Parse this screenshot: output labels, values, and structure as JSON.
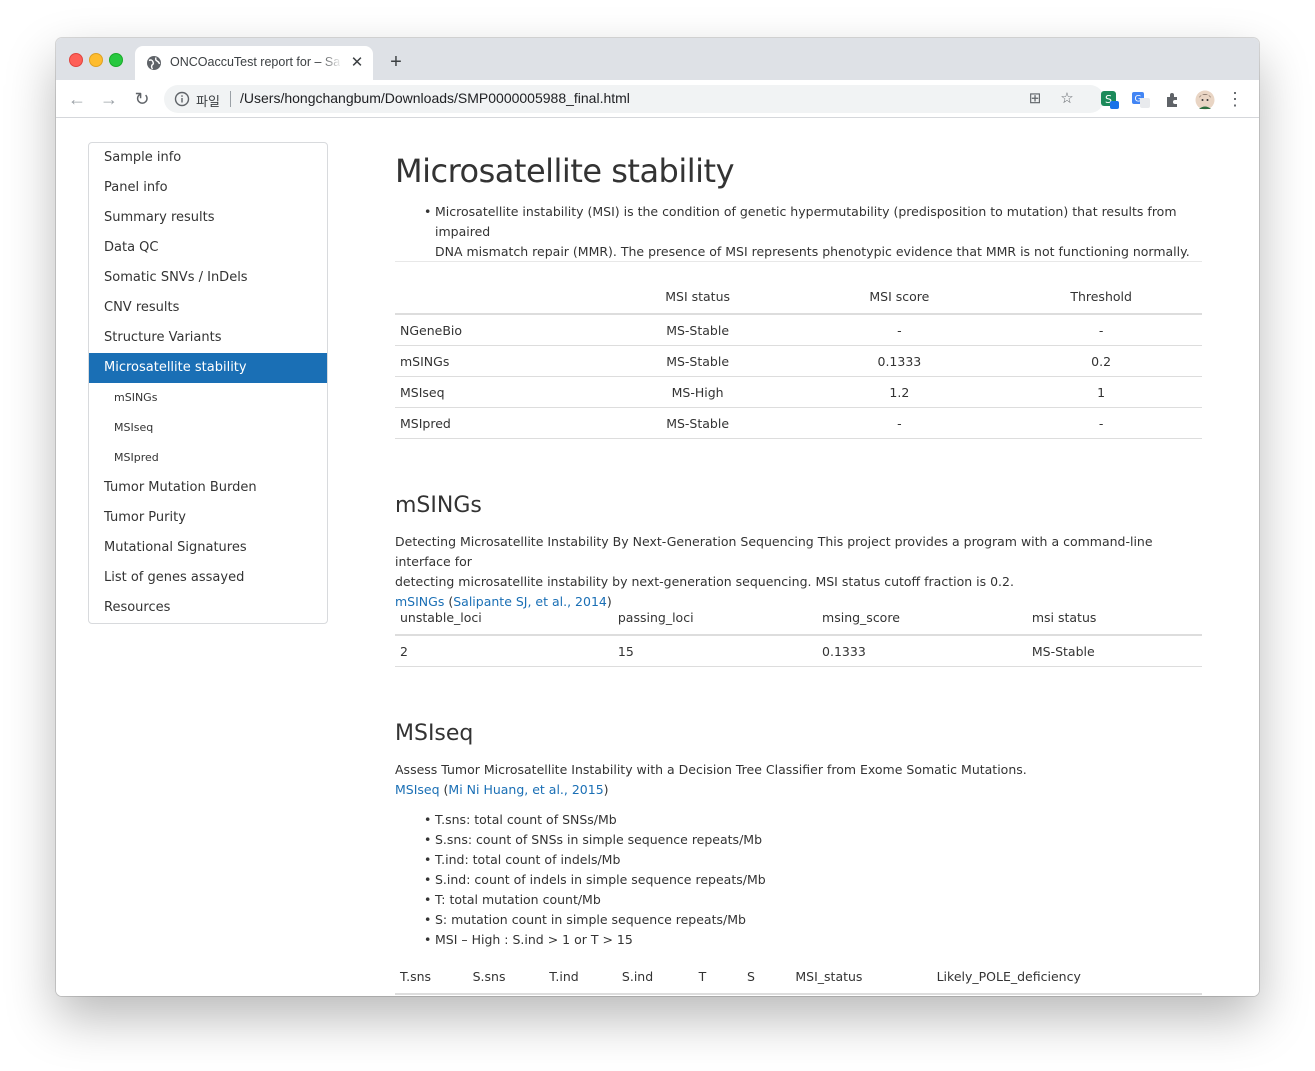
{
  "browser": {
    "tab_title": "ONCOaccuTest report for – Sample",
    "tab_close": "✕",
    "new_tab": "+",
    "nav_back": "←",
    "nav_forward": "→",
    "nav_reload": "↻",
    "scheme_label": "파일",
    "url": "/Users/hongchangbum/Downloads/SMP0000005988_final.html",
    "translate_icon": "⊞",
    "star_icon": "☆",
    "menu_icon": "⋮"
  },
  "sidebar": {
    "items": [
      {
        "label": "Sample info",
        "level": 1,
        "active": false
      },
      {
        "label": "Panel info",
        "level": 1,
        "active": false
      },
      {
        "label": "Summary results",
        "level": 1,
        "active": false
      },
      {
        "label": "Data QC",
        "level": 1,
        "active": false
      },
      {
        "label": "Somatic SNVs / InDels",
        "level": 1,
        "active": false
      },
      {
        "label": "CNV results",
        "level": 1,
        "active": false
      },
      {
        "label": "Structure Variants",
        "level": 1,
        "active": false
      },
      {
        "label": "Microsatellite stability",
        "level": 1,
        "active": true
      },
      {
        "label": "mSINGs",
        "level": 2,
        "active": false
      },
      {
        "label": "MSIseq",
        "level": 2,
        "active": false
      },
      {
        "label": "MSIpred",
        "level": 2,
        "active": false
      },
      {
        "label": "Tumor Mutation Burden",
        "level": 1,
        "active": false
      },
      {
        "label": "Tumor Purity",
        "level": 1,
        "active": false
      },
      {
        "label": "Mutational Signatures",
        "level": 1,
        "active": false
      },
      {
        "label": "List of genes assayed",
        "level": 1,
        "active": false
      },
      {
        "label": "Resources",
        "level": 1,
        "active": false
      }
    ]
  },
  "main": {
    "title": "Microsatellite stability",
    "intro_line1": "Microsatellite instability (MSI) is the condition of genetic hypermutability (predisposition to mutation) that results from impaired",
    "intro_line2": "DNA mismatch repair (MMR). The presence of MSI represents phenotypic evidence that MMR is not functioning normally.",
    "summary_table": {
      "headers": [
        "",
        "MSI status",
        "MSI score",
        "Threshold"
      ],
      "rows": [
        [
          "NGeneBio",
          "MS-Stable",
          "-",
          "-"
        ],
        [
          "mSINGs",
          "MS-Stable",
          "0.1333",
          "0.2"
        ],
        [
          "MSIseq",
          "MS-High",
          "1.2",
          "1"
        ],
        [
          "MSIpred",
          "MS-Stable",
          "-",
          "-"
        ]
      ]
    },
    "msings": {
      "heading": "mSINGs",
      "desc_line1": "Detecting Microsatellite Instability By Next-Generation Sequencing This project provides a program with a command-line interface for",
      "desc_line2": "detecting microsatellite instability by next-generation sequencing. MSI status cutoff fraction is 0.2.",
      "link_tool": "mSINGs",
      "link_ref": "Salipante SJ, et al., 2014",
      "paren_open": "(",
      "paren_close": ")",
      "table": {
        "headers": [
          "unstable_loci",
          "passing_loci",
          "msing_score",
          "msi status"
        ],
        "rows": [
          [
            "2",
            "15",
            "0.1333",
            "MS-Stable"
          ]
        ]
      }
    },
    "msiseq": {
      "heading": "MSIseq",
      "desc": "Assess Tumor Microsatellite Instability with a Decision Tree Classifier from Exome Somatic Mutations.",
      "link_tool": "MSIseq",
      "link_ref": "Mi Ni Huang, et al., 2015",
      "paren_open": "(",
      "paren_close": ")",
      "bullets": [
        "T.sns: total count of SNSs/Mb",
        "S.sns: count of SNSs in simple sequence repeats/Mb",
        "T.ind: total count of indels/Mb",
        "S.ind: count of indels in simple sequence repeats/Mb",
        "T: total mutation count/Mb",
        "S: mutation count in simple sequence repeats/Mb",
        "MSI – High : S.ind > 1 or T > 15"
      ],
      "table_headers": [
        "T.sns",
        "S.sns",
        "T.ind",
        "S.ind",
        "T",
        "S",
        "MSI_status",
        "Likely_POLE_deficiency"
      ]
    }
  },
  "colors": {
    "accent": "#1a6fb5",
    "link": "#1a6fb5",
    "text": "#333333",
    "tabstrip": "#dee1e6"
  }
}
